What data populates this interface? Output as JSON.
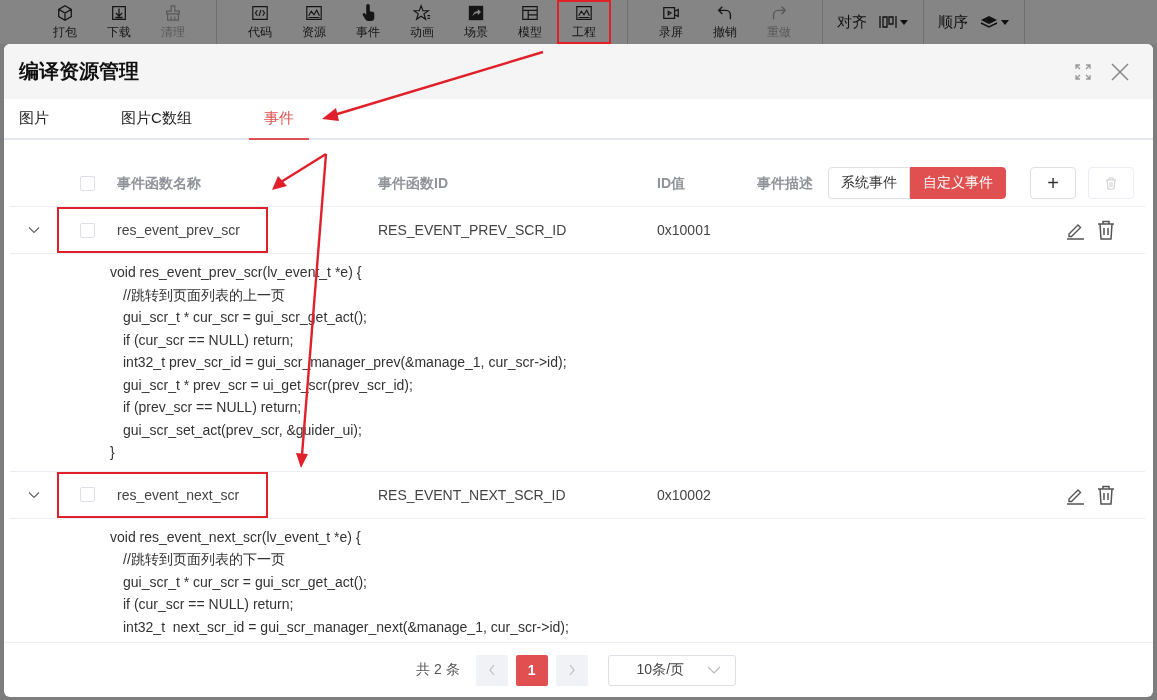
{
  "toolbar": {
    "groups": [
      [
        {
          "label": "打包",
          "disabled": false,
          "highlighted": false
        },
        {
          "label": "下载",
          "disabled": false,
          "highlighted": false
        },
        {
          "label": "清理",
          "disabled": true,
          "highlighted": false
        }
      ],
      [
        {
          "label": "代码",
          "disabled": false,
          "highlighted": false
        },
        {
          "label": "资源",
          "disabled": false,
          "highlighted": false
        },
        {
          "label": "事件",
          "disabled": false,
          "highlighted": false
        },
        {
          "label": "动画",
          "disabled": false,
          "highlighted": false
        },
        {
          "label": "场景",
          "disabled": false,
          "highlighted": false
        },
        {
          "label": "模型",
          "disabled": false,
          "highlighted": false
        },
        {
          "label": "工程",
          "disabled": false,
          "highlighted": true
        }
      ],
      [
        {
          "label": "录屏",
          "disabled": false,
          "highlighted": false
        },
        {
          "label": "撤销",
          "disabled": false,
          "highlighted": false
        },
        {
          "label": "重做",
          "disabled": true,
          "highlighted": false
        }
      ]
    ],
    "menus": [
      {
        "label": "对齐"
      },
      {
        "label": "顺序"
      }
    ]
  },
  "dialog": {
    "title": "编译资源管理",
    "tabs": [
      {
        "label": "图片",
        "selected": false
      },
      {
        "label": "图片C数组",
        "selected": false
      },
      {
        "label": "事件",
        "selected": true
      }
    ],
    "table": {
      "all_checked": false,
      "columns": [
        "事件函数名称",
        "事件函数ID",
        "ID值",
        "事件描述"
      ],
      "filter": [
        {
          "label": "系统事件",
          "selected": false
        },
        {
          "label": "自定义事件",
          "selected": true
        }
      ],
      "add_button": "+",
      "rows": [
        {
          "name": "res_event_prev_scr",
          "id": "RES_EVENT_PREV_SCR_ID",
          "value": "0x10001",
          "checked": false,
          "expanded": true,
          "highlighted": true,
          "code": [
            {
              "text": "void res_event_prev_scr(lv_event_t *e) {",
              "indent": false
            },
            {
              "text": "//跳转到页面列表的上一页",
              "indent": true
            },
            {
              "text": "gui_scr_t * cur_scr = gui_scr_get_act();",
              "indent": true
            },
            {
              "text": "if (cur_scr == NULL) return;",
              "indent": true
            },
            {
              "text": "int32_t prev_scr_id = gui_scr_manager_prev(&manage_1, cur_scr->id);",
              "indent": true
            },
            {
              "text": "gui_scr_t * prev_scr = ui_get_scr(prev_scr_id);",
              "indent": true
            },
            {
              "text": "if (prev_scr == NULL) return;",
              "indent": true
            },
            {
              "text": "gui_scr_set_act(prev_scr, &guider_ui);",
              "indent": true
            },
            {
              "text": "}",
              "indent": false
            }
          ]
        },
        {
          "name": "res_event_next_scr",
          "id": "RES_EVENT_NEXT_SCR_ID",
          "value": "0x10002",
          "checked": false,
          "expanded": true,
          "highlighted": true,
          "code": [
            {
              "text": "void res_event_next_scr(lv_event_t *e) {",
              "indent": false
            },
            {
              "text": "//跳转到页面列表的下一页",
              "indent": true
            },
            {
              "text": "gui_scr_t * cur_scr = gui_scr_get_act();",
              "indent": true
            },
            {
              "text": "if (cur_scr == NULL) return;",
              "indent": true
            },
            {
              "text": "int32_t  next_scr_id = gui_scr_manager_next(&manage_1, cur_scr->id);",
              "indent": true
            }
          ]
        }
      ]
    },
    "pagination": {
      "total": "共 2 条",
      "pages": [
        {
          "label": "1",
          "selected": true
        }
      ],
      "page_size": "10条/页"
    }
  }
}
